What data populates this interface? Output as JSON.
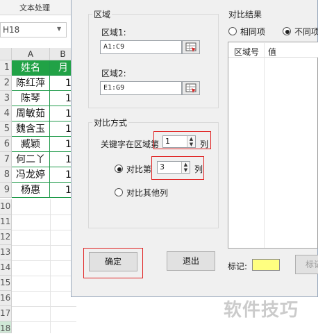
{
  "excel": {
    "ribbon_tab": "文本处理",
    "name_box": "H18",
    "name_box_arrow": "▼",
    "columns": [
      "A",
      "B"
    ],
    "header_row": [
      "姓名",
      "月"
    ],
    "names": [
      "陈红萍",
      "陈琴",
      "周敏茹",
      "魏含玉",
      "臧颖",
      "何二丫",
      "冯龙婷",
      "杨惠"
    ],
    "col_b_values": [
      "1",
      "1",
      "1",
      "1",
      "1",
      "1",
      "1",
      "1"
    ],
    "row_numbers": [
      "1",
      "2",
      "3",
      "4",
      "5",
      "6",
      "7",
      "8",
      "9",
      "10",
      "11",
      "12",
      "13",
      "14",
      "15",
      "16",
      "17",
      "18"
    ]
  },
  "dialog": {
    "range_group": {
      "title": "区域",
      "range1_label": "区域1:",
      "range1_value": "A1:C9",
      "range2_label": "区域2:",
      "range2_value": "E1:G9"
    },
    "method_group": {
      "title": "对比方式",
      "key_prefix": "关键字在区域第",
      "key_value": "1",
      "key_suffix": "列",
      "compare_label": "对比第",
      "compare_value": "3",
      "compare_suffix": "列",
      "other_label": "对比其他列"
    },
    "ok_button": "确定",
    "exit_button": "退出",
    "result_group": {
      "title": "对比结果",
      "same_label": "相同项",
      "diff_label": "不同项",
      "col_region": "区域号",
      "col_value": "值"
    },
    "mark_label": "标记:",
    "mark_color": "#ffff80",
    "mark_button": "标记"
  },
  "watermark": "软件技巧"
}
